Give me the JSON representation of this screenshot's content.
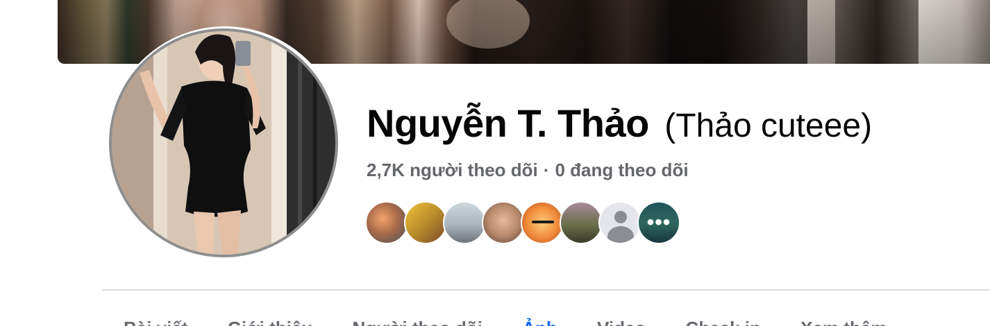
{
  "profile": {
    "name": "Nguyễn T. Thảo",
    "alternate_name": "(Thảo cuteee)",
    "followers_text": "2,7K người theo dõi",
    "separator": "·",
    "following_text": "0 đang theo dõi"
  },
  "follower_avatars": [
    {
      "label": "follower-avatar-1"
    },
    {
      "label": "follower-avatar-2"
    },
    {
      "label": "follower-avatar-3"
    },
    {
      "label": "follower-avatar-4"
    },
    {
      "label": "follower-avatar-5"
    },
    {
      "label": "follower-avatar-6"
    },
    {
      "label": "follower-avatar-7"
    },
    {
      "label": "follower-avatar-more",
      "icon": "more-icon",
      "text": "•••"
    }
  ],
  "tabs": [
    {
      "label": "Bài viết"
    },
    {
      "label": "Giới thiệu"
    },
    {
      "label": "Người theo dõi"
    },
    {
      "label": "Ảnh",
      "active": true
    },
    {
      "label": "Video"
    },
    {
      "label": "Check in"
    },
    {
      "label": "Xem thêm"
    }
  ],
  "colors": {
    "text_primary": "#050505",
    "text_secondary": "#65676b",
    "accent": "#0866ff",
    "divider": "#d9dadd"
  }
}
